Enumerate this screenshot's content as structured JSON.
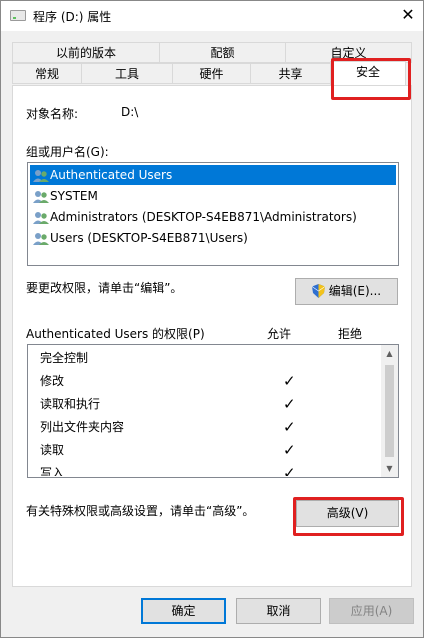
{
  "window": {
    "title": "程序 (D:) 属性",
    "close_glyph": "✕"
  },
  "tabs": {
    "row1": [
      "以前的版本",
      "配额",
      "自定义"
    ],
    "row2": [
      "常规",
      "工具",
      "硬件",
      "共享",
      "安全"
    ],
    "active": "安全"
  },
  "security": {
    "object_name_label": "对象名称:",
    "object_name_value": "D:\\",
    "group_label": "组或用户名(G):",
    "users": [
      {
        "name": "Authenticated Users",
        "selected": true
      },
      {
        "name": "SYSTEM",
        "selected": false
      },
      {
        "name": "Administrators (DESKTOP-S4EB871\\Administrators)",
        "selected": false
      },
      {
        "name": "Users (DESKTOP-S4EB871\\Users)",
        "selected": false
      }
    ],
    "change_hint": "要更改权限，请单击“编辑”。",
    "edit_button": "编辑(E)...",
    "permissions_label": "Authenticated Users 的权限(P)",
    "allow_header": "允许",
    "deny_header": "拒绝",
    "permissions": [
      {
        "name": "完全控制",
        "allow": "",
        "deny": ""
      },
      {
        "name": "修改",
        "allow": "✓",
        "deny": ""
      },
      {
        "name": "读取和执行",
        "allow": "✓",
        "deny": ""
      },
      {
        "name": "列出文件夹内容",
        "allow": "✓",
        "deny": ""
      },
      {
        "name": "读取",
        "allow": "✓",
        "deny": ""
      },
      {
        "name": "写入",
        "allow": "✓",
        "deny": ""
      }
    ],
    "advanced_hint": "有关特殊权限或高级设置，请单击“高级”。",
    "advanced_button": "高级(V)"
  },
  "footer": {
    "ok": "确定",
    "cancel": "取消",
    "apply": "应用(A)"
  },
  "colors": {
    "selection": "#0078d7",
    "highlight_box": "#e02020"
  }
}
